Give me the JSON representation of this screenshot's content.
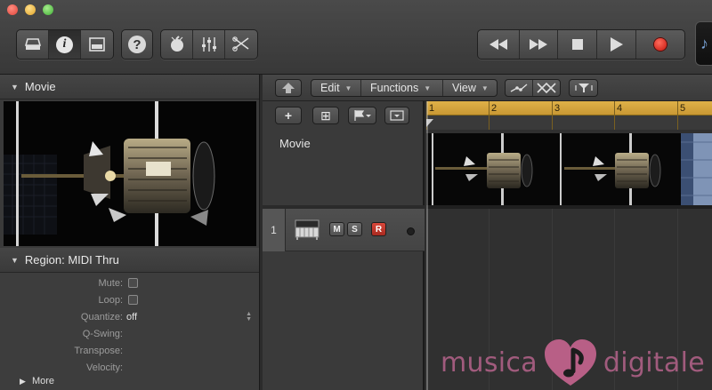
{
  "window": {
    "title": ""
  },
  "toolbar": {
    "view_buttons": [
      "library-icon",
      "info-icon",
      "editor-icon"
    ],
    "help_label": "?",
    "tool_buttons": [
      "metronome-icon",
      "mixer-icon",
      "scissors-icon"
    ],
    "transport": [
      "rewind-icon",
      "fast-forward-icon",
      "stop-icon",
      "play-icon",
      "record-icon"
    ]
  },
  "inspector": {
    "movie_header": "Movie",
    "region_header": "Region: MIDI Thru",
    "properties": [
      {
        "label": "Mute:",
        "control": "checkbox"
      },
      {
        "label": "Loop:",
        "control": "checkbox"
      },
      {
        "label": "Quantize:",
        "control": "select",
        "value": "off"
      },
      {
        "label": "Q-Swing:",
        "control": "none"
      },
      {
        "label": "Transpose:",
        "control": "none"
      },
      {
        "label": "Velocity:",
        "control": "none"
      }
    ],
    "more_label": "More"
  },
  "tracks_menu": {
    "edit": "Edit",
    "functions": "Functions",
    "view": "View"
  },
  "header_buttons": {
    "add": "+",
    "add_folder": "⊞"
  },
  "tracks": {
    "movie_label": "Movie",
    "track1": {
      "number": "1",
      "mute": "M",
      "solo": "S",
      "record": "R"
    }
  },
  "ruler": {
    "bars": [
      "1",
      "2",
      "3",
      "4",
      "5"
    ]
  },
  "watermark": {
    "left": "musica",
    "right": "digitale"
  },
  "colors": {
    "ruler": "#d8a83e",
    "record": "#d9473a",
    "watermark": "#a15b7d"
  }
}
